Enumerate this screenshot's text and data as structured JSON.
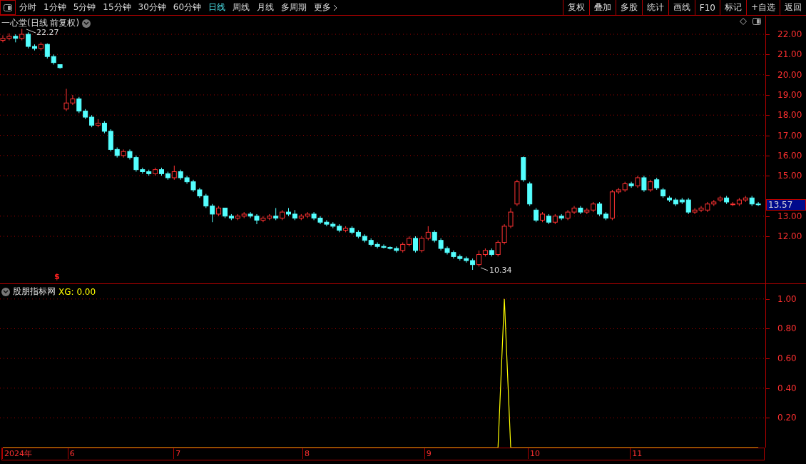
{
  "toolbar": {
    "tabs": [
      {
        "label": "分时",
        "selected": false
      },
      {
        "label": "1分钟",
        "selected": false
      },
      {
        "label": "5分钟",
        "selected": false
      },
      {
        "label": "15分钟",
        "selected": false
      },
      {
        "label": "30分钟",
        "selected": false
      },
      {
        "label": "60分钟",
        "selected": false
      },
      {
        "label": "日线",
        "selected": true
      },
      {
        "label": "周线",
        "selected": false
      },
      {
        "label": "月线",
        "selected": false
      },
      {
        "label": "多周期",
        "selected": false
      }
    ],
    "more": "更多",
    "buttons": [
      "复权",
      "叠加",
      "多股",
      "统计",
      "画线",
      "F10",
      "标记",
      "+自选",
      "返回"
    ]
  },
  "price_chart": {
    "title": "一心堂(日线 前复权)",
    "high_label": "22.27",
    "low_label": "10.34",
    "marker": "$",
    "current_price": "13.57",
    "chart_data": {
      "type": "candlestick",
      "ylim": [
        9.67,
        22.92
      ],
      "grid": true,
      "yticks": [
        {
          "value": 22,
          "label": "22.00"
        },
        {
          "value": 21,
          "label": "21.00"
        },
        {
          "value": 20,
          "label": "20.00"
        },
        {
          "value": 19,
          "label": "19.00"
        },
        {
          "value": 18,
          "label": "18.00"
        },
        {
          "value": 17,
          "label": "17.00"
        },
        {
          "value": 16,
          "label": "16.00"
        },
        {
          "value": 15,
          "label": "15.00"
        },
        {
          "value": 13,
          "label": "13.00"
        },
        {
          "value": 12,
          "label": "12.00"
        }
      ],
      "ohlc": [
        [
          21.7,
          21.95,
          21.6,
          21.8
        ],
        [
          21.8,
          22.05,
          21.7,
          21.9
        ],
        [
          21.9,
          22.0,
          21.6,
          21.8
        ],
        [
          21.8,
          22.27,
          21.7,
          22.0
        ],
        [
          22.0,
          22.1,
          21.3,
          21.4
        ],
        [
          21.4,
          21.5,
          21.2,
          21.3
        ],
        [
          21.3,
          21.6,
          21.2,
          21.5
        ],
        [
          21.5,
          21.55,
          20.8,
          20.9
        ],
        [
          20.9,
          21.0,
          20.5,
          20.6
        ],
        [
          20.5,
          20.5,
          20.3,
          20.35
        ],
        [
          18.3,
          19.3,
          18.2,
          18.6
        ],
        [
          18.6,
          19.0,
          18.5,
          18.8
        ],
        [
          18.8,
          18.9,
          18.1,
          18.2
        ],
        [
          18.2,
          18.3,
          17.8,
          17.9
        ],
        [
          17.9,
          18.0,
          17.4,
          17.5
        ],
        [
          17.5,
          17.8,
          17.4,
          17.6
        ],
        [
          17.6,
          17.7,
          17.1,
          17.2
        ],
        [
          17.2,
          17.3,
          16.2,
          16.3
        ],
        [
          16.3,
          16.4,
          15.9,
          16.0
        ],
        [
          16.0,
          16.3,
          15.9,
          16.2
        ],
        [
          16.2,
          16.3,
          15.8,
          15.9
        ],
        [
          15.9,
          16.0,
          15.2,
          15.3
        ],
        [
          15.3,
          15.4,
          15.1,
          15.2
        ],
        [
          15.2,
          15.3,
          15.0,
          15.1
        ],
        [
          15.1,
          15.4,
          15.0,
          15.3
        ],
        [
          15.3,
          15.4,
          15.0,
          15.1
        ],
        [
          15.1,
          15.2,
          14.8,
          14.9
        ],
        [
          14.9,
          15.5,
          14.8,
          15.2
        ],
        [
          15.2,
          15.3,
          14.8,
          14.9
        ],
        [
          14.9,
          15.0,
          14.6,
          14.7
        ],
        [
          14.7,
          14.8,
          14.2,
          14.3
        ],
        [
          14.3,
          14.4,
          13.9,
          14.0
        ],
        [
          14.0,
          14.1,
          13.4,
          13.5
        ],
        [
          13.5,
          13.6,
          12.7,
          13.1
        ],
        [
          13.1,
          13.5,
          13.0,
          13.4
        ],
        [
          13.4,
          13.4,
          12.9,
          13.0
        ],
        [
          13.0,
          13.1,
          12.8,
          12.9
        ],
        [
          12.9,
          13.1,
          12.8,
          13.0
        ],
        [
          13.0,
          13.2,
          12.9,
          13.1
        ],
        [
          13.1,
          13.2,
          12.9,
          13.0
        ],
        [
          13.0,
          13.1,
          12.6,
          12.8
        ],
        [
          12.8,
          13.0,
          12.7,
          12.9
        ],
        [
          12.9,
          13.1,
          12.8,
          13.0
        ],
        [
          13.0,
          13.4,
          12.8,
          12.9
        ],
        [
          12.9,
          13.3,
          12.8,
          13.2
        ],
        [
          13.2,
          13.4,
          13.0,
          13.1
        ],
        [
          13.1,
          13.3,
          12.8,
          12.9
        ],
        [
          12.9,
          13.1,
          12.8,
          13.0
        ],
        [
          13.0,
          13.2,
          12.9,
          13.1
        ],
        [
          13.1,
          13.2,
          12.8,
          12.9
        ],
        [
          12.9,
          13.0,
          12.6,
          12.7
        ],
        [
          12.7,
          12.8,
          12.5,
          12.6
        ],
        [
          12.6,
          12.7,
          12.4,
          12.5
        ],
        [
          12.5,
          12.6,
          12.2,
          12.3
        ],
        [
          12.3,
          12.5,
          12.2,
          12.4
        ],
        [
          12.4,
          12.5,
          12.1,
          12.2
        ],
        [
          12.2,
          12.3,
          11.9,
          12.0
        ],
        [
          12.0,
          12.1,
          11.7,
          11.8
        ],
        [
          11.8,
          11.9,
          11.5,
          11.6
        ],
        [
          11.6,
          11.7,
          11.4,
          11.5
        ],
        [
          11.5,
          11.6,
          11.4,
          11.45
        ],
        [
          11.45,
          11.5,
          11.35,
          11.4
        ],
        [
          11.4,
          11.5,
          11.2,
          11.3
        ],
        [
          11.3,
          11.7,
          11.2,
          11.6
        ],
        [
          11.6,
          12.0,
          11.5,
          11.9
        ],
        [
          11.9,
          12.0,
          11.2,
          11.3
        ],
        [
          11.3,
          12.0,
          11.2,
          11.9
        ],
        [
          11.9,
          12.5,
          11.8,
          12.2
        ],
        [
          12.2,
          12.3,
          11.7,
          11.8
        ],
        [
          11.8,
          11.9,
          11.3,
          11.4
        ],
        [
          11.4,
          11.5,
          11.1,
          11.2
        ],
        [
          11.2,
          11.3,
          10.9,
          11.0
        ],
        [
          11.0,
          11.1,
          10.8,
          10.9
        ],
        [
          10.9,
          11.0,
          10.7,
          10.8
        ],
        [
          10.8,
          10.9,
          10.34,
          10.6
        ],
        [
          10.6,
          11.3,
          10.5,
          11.1
        ],
        [
          11.1,
          11.4,
          11.0,
          11.3
        ],
        [
          11.3,
          11.4,
          11.0,
          11.1
        ],
        [
          11.1,
          11.8,
          11.0,
          11.7
        ],
        [
          11.7,
          12.6,
          11.6,
          12.5
        ],
        [
          12.5,
          13.4,
          12.4,
          13.2
        ],
        [
          13.6,
          14.8,
          13.5,
          14.7
        ],
        [
          15.9,
          15.95,
          14.7,
          14.8
        ],
        [
          14.6,
          14.7,
          13.5,
          13.6
        ],
        [
          13.3,
          13.4,
          12.7,
          12.8
        ],
        [
          12.8,
          13.2,
          12.7,
          13.1
        ],
        [
          13.0,
          13.1,
          12.6,
          12.7
        ],
        [
          12.7,
          13.1,
          12.6,
          13.0
        ],
        [
          13.0,
          13.1,
          12.8,
          12.9
        ],
        [
          12.9,
          13.3,
          12.8,
          13.2
        ],
        [
          13.2,
          13.5,
          13.1,
          13.4
        ],
        [
          13.4,
          13.5,
          13.1,
          13.2
        ],
        [
          13.2,
          13.4,
          13.1,
          13.3
        ],
        [
          13.3,
          13.7,
          13.2,
          13.6
        ],
        [
          13.6,
          13.7,
          13.0,
          13.1
        ],
        [
          13.1,
          13.2,
          12.8,
          12.9
        ],
        [
          12.9,
          14.3,
          12.8,
          14.2
        ],
        [
          14.2,
          14.4,
          14.1,
          14.3
        ],
        [
          14.3,
          14.7,
          14.2,
          14.6
        ],
        [
          14.6,
          14.7,
          14.4,
          14.5
        ],
        [
          14.5,
          15.0,
          14.4,
          14.9
        ],
        [
          14.9,
          15.0,
          14.2,
          14.3
        ],
        [
          14.3,
          14.8,
          14.2,
          14.7
        ],
        [
          14.8,
          14.9,
          14.3,
          14.4
        ],
        [
          14.3,
          14.4,
          13.9,
          14.0
        ],
        [
          13.9,
          14.0,
          13.7,
          13.8
        ],
        [
          13.8,
          13.9,
          13.5,
          13.6
        ],
        [
          13.8,
          13.9,
          13.6,
          13.7
        ],
        [
          13.8,
          13.9,
          13.1,
          13.2
        ],
        [
          13.2,
          13.4,
          13.1,
          13.3
        ],
        [
          13.3,
          13.5,
          13.2,
          13.4
        ],
        [
          13.3,
          13.7,
          13.2,
          13.6
        ],
        [
          13.6,
          13.8,
          13.5,
          13.7
        ],
        [
          13.8,
          14.0,
          13.7,
          13.9
        ],
        [
          13.9,
          14.0,
          13.6,
          13.7
        ],
        [
          13.6,
          13.7,
          13.5,
          13.6
        ],
        [
          13.6,
          13.9,
          13.5,
          13.8
        ],
        [
          13.8,
          14.0,
          13.7,
          13.9
        ],
        [
          13.9,
          14.0,
          13.5,
          13.6
        ],
        [
          13.6,
          13.7,
          13.5,
          13.57
        ]
      ]
    }
  },
  "indicator": {
    "name": "股朋指标网",
    "reading": ": 0.00",
    "chart_data": {
      "type": "line",
      "ylim": [
        0,
        1.1
      ],
      "grid": true,
      "yticks": [
        {
          "value": 0.2,
          "label": "0.20"
        },
        {
          "value": 0.4,
          "label": "0.40"
        },
        {
          "value": 0.6,
          "label": "0.60"
        },
        {
          "value": 0.8,
          "label": "0.80"
        },
        {
          "value": 1,
          "label": "1.00"
        }
      ],
      "series": [
        {
          "name": "XG",
          "color": "#ffff00",
          "values": [
            0,
            0,
            0,
            0,
            0,
            0,
            0,
            0,
            0,
            0,
            0,
            0,
            0,
            0,
            0,
            0,
            0,
            0,
            0,
            0,
            0,
            0,
            0,
            0,
            0,
            0,
            0,
            0,
            0,
            0,
            0,
            0,
            0,
            0,
            0,
            0,
            0,
            0,
            0,
            0,
            0,
            0,
            0,
            0,
            0,
            0,
            0,
            0,
            0,
            0,
            0,
            0,
            0,
            0,
            0,
            0,
            0,
            0,
            0,
            0,
            0,
            0,
            0,
            0,
            0,
            0,
            0,
            0,
            0,
            0,
            0,
            0,
            0,
            0,
            0,
            0,
            0,
            0,
            0,
            1,
            0,
            0,
            0,
            0,
            0,
            0,
            0,
            0,
            0,
            0,
            0,
            0,
            0,
            0,
            0,
            0,
            0,
            0,
            0,
            0,
            0,
            0,
            0,
            0,
            0,
            0,
            0,
            0,
            0,
            0,
            0,
            0,
            0,
            0,
            0,
            0,
            0,
            0,
            0,
            0
          ]
        }
      ]
    }
  },
  "date_axis": [
    "2024年",
    "6",
    "7",
    "8",
    "9",
    "10",
    "11"
  ]
}
